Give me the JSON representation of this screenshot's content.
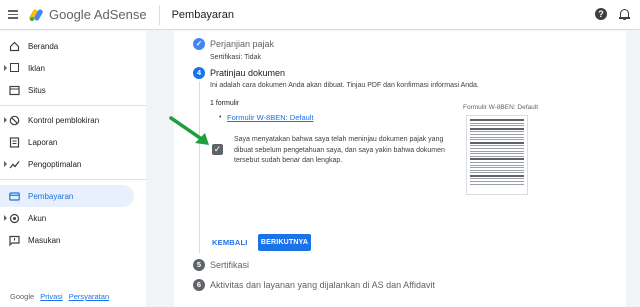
{
  "header": {
    "brand": "Google AdSense",
    "page_title": "Pembayaran",
    "icons": [
      "menu-icon",
      "adsense-logo",
      "help-icon",
      "notifications-icon"
    ]
  },
  "sidebar": {
    "items": [
      {
        "label": "Beranda",
        "icon": "home-icon",
        "expandable": false,
        "active": false
      },
      {
        "label": "Iklan",
        "icon": "ads-icon",
        "expandable": true,
        "active": false
      },
      {
        "label": "Situs",
        "icon": "sites-icon",
        "expandable": false,
        "active": false
      },
      {
        "label": "Kontrol pemblokiran",
        "icon": "block-icon",
        "expandable": true,
        "active": false
      },
      {
        "label": "Laporan",
        "icon": "reports-icon",
        "expandable": false,
        "active": false
      },
      {
        "label": "Pengoptimalan",
        "icon": "optimization-icon",
        "expandable": true,
        "active": false
      },
      {
        "label": "Pembayaran",
        "icon": "payments-icon",
        "expandable": false,
        "active": true
      },
      {
        "label": "Akun",
        "icon": "account-icon",
        "expandable": true,
        "active": false
      },
      {
        "label": "Masukan",
        "icon": "feedback-icon",
        "expandable": false,
        "active": false
      }
    ],
    "footer": {
      "google": "Google",
      "privacy": "Privasi",
      "terms": "Persyaratan"
    }
  },
  "wizard": {
    "step_treaty": {
      "title": "Perjanjian pajak",
      "subtitle": "Sertifikasi: Tidak",
      "state": "done"
    },
    "step_preview": {
      "number": "4",
      "title": "Pratinjau dokumen",
      "description": "Ini adalah cara dokumen Anda akan dibuat. Tinjau PDF dan konfirmasi informasi Anda.",
      "count_label": "1 formulir",
      "form_link": "Formulir W-8BEN: Default",
      "confirm_text": "Saya menyatakan bahwa saya telah meninjau dokumen pajak yang dibuat sebelum pengetahuan saya, dan saya yakin bahwa dokumen tersebut sudah benar dan lengkap.",
      "confirm_checked": true,
      "thumbnail_caption": "Formulir W-8BEN: Default",
      "back_button": "KEMBALI",
      "next_button": "BERIKUTNYA"
    },
    "step_certification": {
      "number": "5",
      "title": "Sertifikasi"
    },
    "step_activities": {
      "number": "6",
      "title": "Aktivitas dan layanan yang dijalankan di AS dan Affidavit"
    }
  },
  "colors": {
    "accent": "#1a73e8",
    "active_nav_bg": "#e8f0fe",
    "annotation_arrow": "#1e9e3e"
  }
}
